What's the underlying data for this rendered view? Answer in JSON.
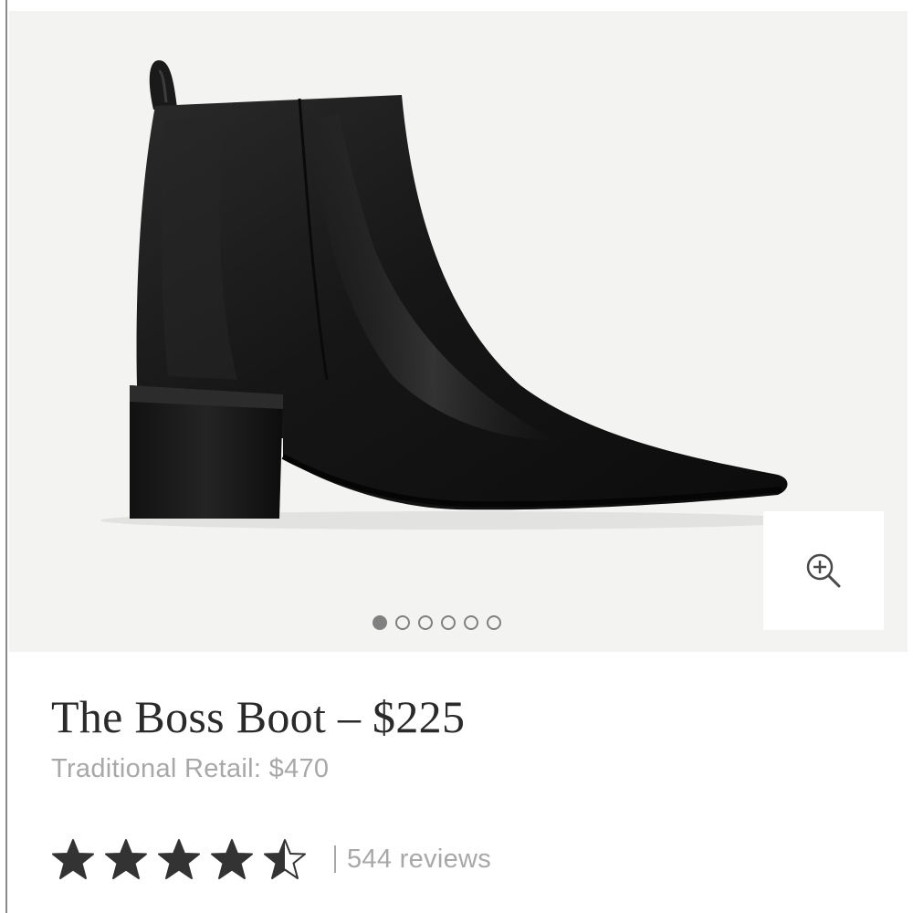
{
  "product": {
    "title": "The Boss Boot – $225",
    "traditional_retail": "Traditional Retail: $470"
  },
  "gallery": {
    "image_alt": "black leather ankle boot",
    "zoom_icon": "zoom-in-icon",
    "total_images": 6,
    "active_index": 0
  },
  "rating": {
    "stars": 4.5,
    "max_stars": 5,
    "reviews_label": "544 reviews"
  },
  "colors": {
    "gallery_background": "#f3f3f1",
    "star": "#333333",
    "muted_text": "#a8a8a8",
    "title_text": "#2a2a2a"
  }
}
